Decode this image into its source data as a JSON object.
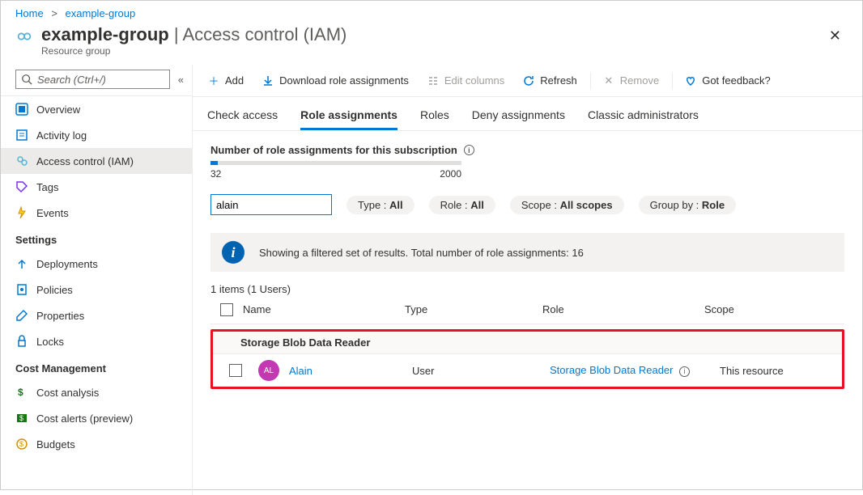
{
  "breadcrumb": {
    "home": "Home",
    "current": "example-group"
  },
  "header": {
    "title": "example-group",
    "divider": " | ",
    "page": "Access control (IAM)",
    "subtitle": "Resource group"
  },
  "sidebar": {
    "search_placeholder": "Search (Ctrl+/)",
    "items": [
      {
        "label": "Overview"
      },
      {
        "label": "Activity log"
      },
      {
        "label": "Access control (IAM)"
      },
      {
        "label": "Tags"
      },
      {
        "label": "Events"
      }
    ],
    "settings_header": "Settings",
    "settings": [
      {
        "label": "Deployments"
      },
      {
        "label": "Policies"
      },
      {
        "label": "Properties"
      },
      {
        "label": "Locks"
      }
    ],
    "cost_header": "Cost Management",
    "cost": [
      {
        "label": "Cost analysis"
      },
      {
        "label": "Cost alerts (preview)"
      },
      {
        "label": "Budgets"
      }
    ]
  },
  "cmdbar": {
    "add": "Add",
    "download": "Download role assignments",
    "edit": "Edit columns",
    "refresh": "Refresh",
    "remove": "Remove",
    "feedback": "Got feedback?"
  },
  "tabs": {
    "t0": "Check access",
    "t1": "Role assignments",
    "t2": "Roles",
    "t3": "Deny assignments",
    "t4": "Classic administrators"
  },
  "metric": {
    "label": "Number of role assignments for this subscription",
    "current": "32",
    "max": "2000"
  },
  "filters": {
    "search_value": "alain",
    "type_label": "Type : ",
    "type_value": "All",
    "role_label": "Role : ",
    "role_value": "All",
    "scope_label": "Scope : ",
    "scope_value": "All scopes",
    "group_label": "Group by : ",
    "group_value": "Role"
  },
  "banner": "Showing a filtered set of results. Total number of role assignments: 16",
  "tablecount": "1 items (1 Users)",
  "columns": {
    "name": "Name",
    "type": "Type",
    "role": "Role",
    "scope": "Scope"
  },
  "group": "Storage Blob Data Reader",
  "row": {
    "avatar": "AL",
    "name": "Alain",
    "type": "User",
    "role": "Storage Blob Data Reader",
    "scope": "This resource"
  }
}
